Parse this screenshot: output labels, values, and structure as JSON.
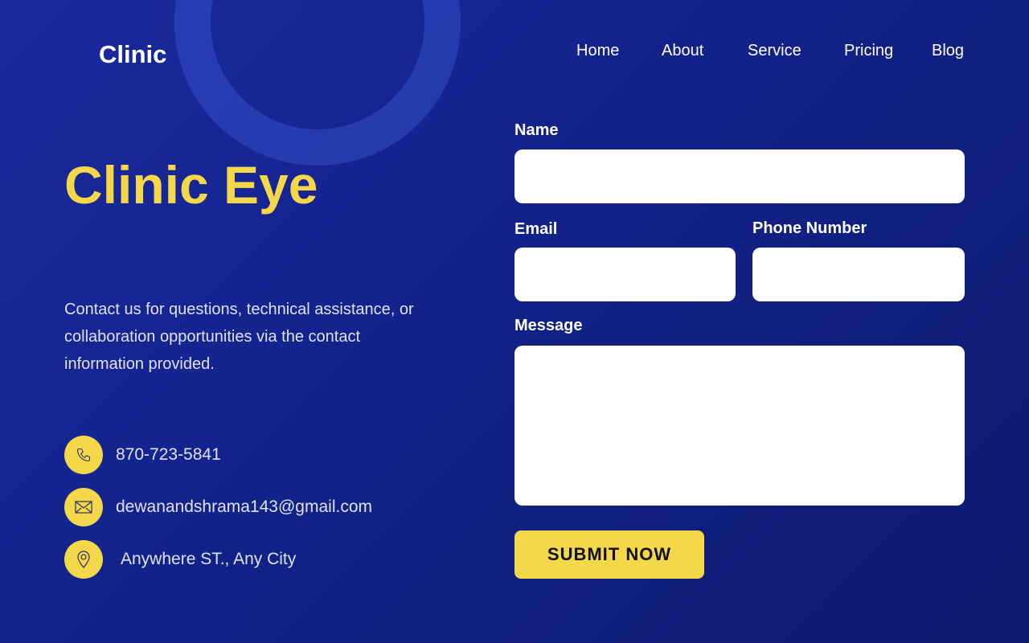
{
  "brand": "Clinic",
  "nav": [
    "Home",
    "About",
    "Service",
    "Pricing",
    "Blog"
  ],
  "hero": {
    "title": "Clinic Eye",
    "description": "Contact us for questions, technical assistance, or collaboration opportunities via the contact information provided."
  },
  "contacts": {
    "phone": "870-723-5841",
    "email": "dewanandshrama143@gmail.com",
    "address": "Anywhere ST., Any City"
  },
  "form": {
    "name_label": "Name",
    "email_label": "Email",
    "phone_label": "Phone Number",
    "message_label": "Message",
    "submit_label": "SUBMIT NOW"
  },
  "colors": {
    "accent": "#f5d84a",
    "background": "#13228a"
  }
}
